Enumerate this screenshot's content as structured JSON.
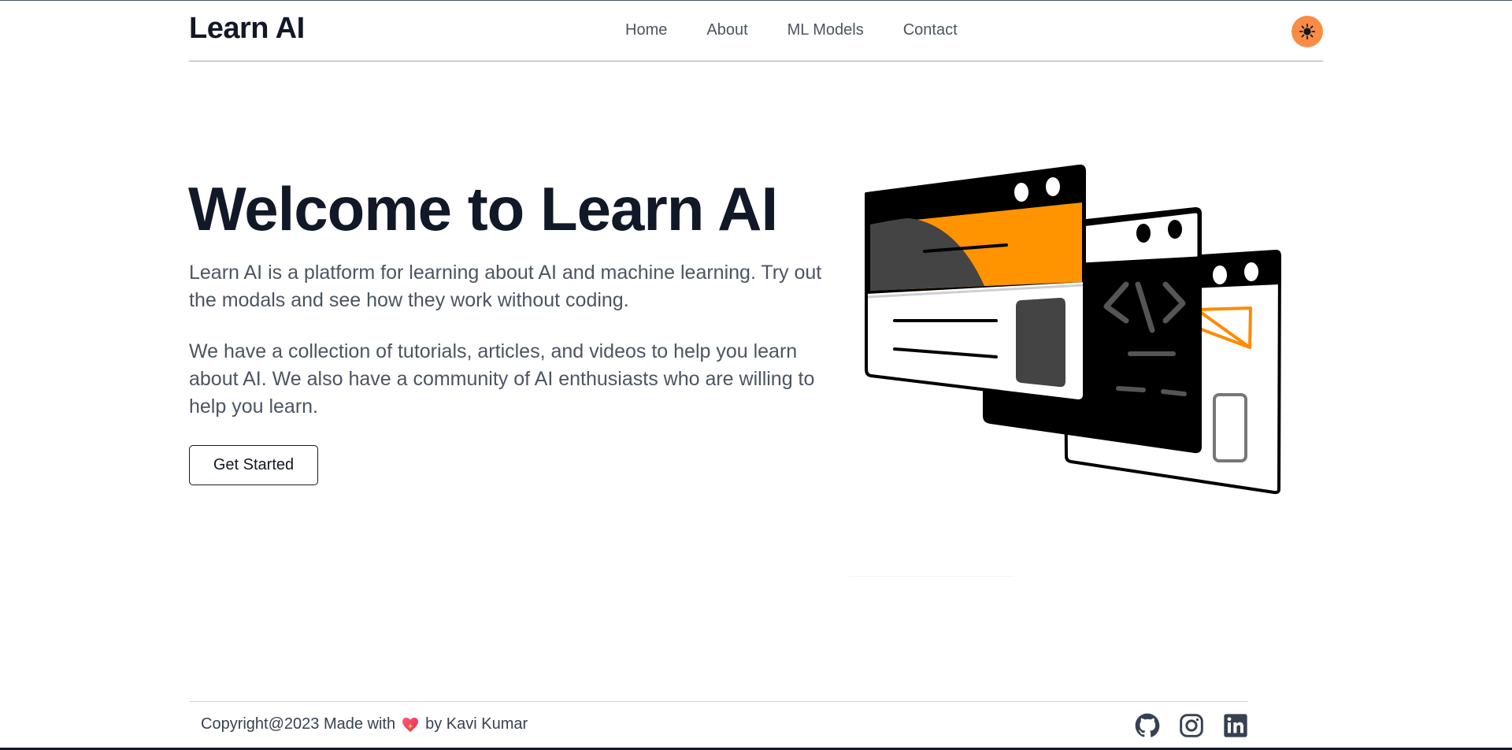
{
  "header": {
    "brand": "Learn AI",
    "nav": [
      "Home",
      "About",
      "ML Models",
      "Contact"
    ],
    "theme_icon": "sun-icon",
    "accent_color": "#fb8c45"
  },
  "hero": {
    "title": "Welcome to Learn AI",
    "paragraph1": "Learn AI is a platform for learning about AI and machine learning. Try out the modals and see how they work without coding.",
    "paragraph2": "We have a collection of tutorials, articles, and videos to help you learn about AI. We also have a community of AI enthusiasts who are willing to help you learn.",
    "cta_label": "Get Started",
    "illustration_icon": "browser-windows-illustration"
  },
  "footer": {
    "copyright_prefix": "Copyright@2023 Made with",
    "copyright_suffix": "by Kavi Kumar",
    "heart_icon": "heart-icon",
    "socials": [
      "github-icon",
      "instagram-icon",
      "linkedin-icon"
    ]
  }
}
